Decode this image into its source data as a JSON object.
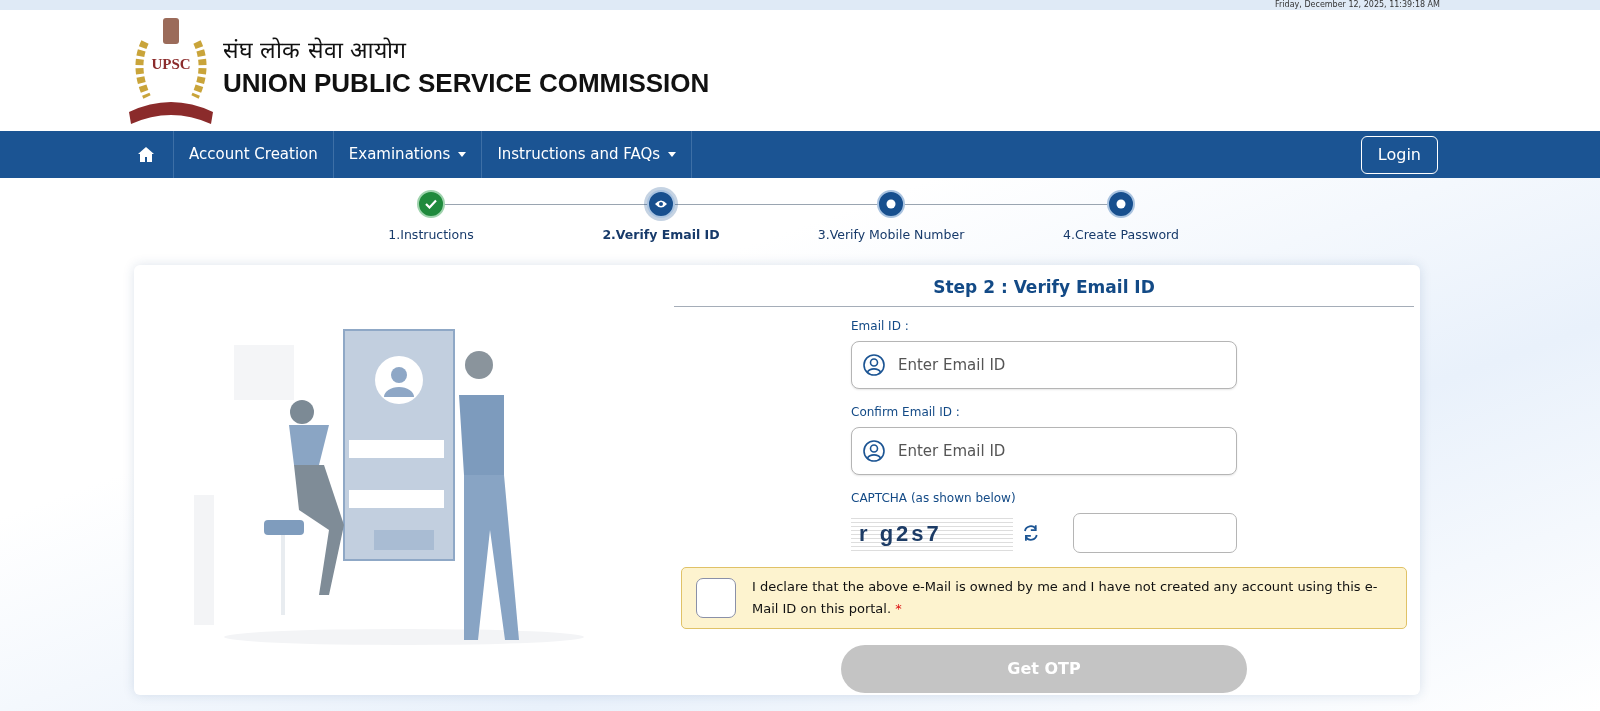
{
  "top_bar": {
    "datetime": "Friday, December 12, 2025, 11:39:18 AM"
  },
  "header": {
    "logo_text": "UPSC",
    "title_hindi": "संघ लोक सेवा आयोग",
    "title_english": "UNION PUBLIC SERVICE COMMISSION"
  },
  "navbar": {
    "items": [
      {
        "kind": "home"
      },
      {
        "kind": "link",
        "label": "Account Creation"
      },
      {
        "kind": "dropdown",
        "label": "Examinations"
      },
      {
        "kind": "dropdown",
        "label": "Instructions and FAQs"
      }
    ],
    "login": "Login"
  },
  "steps": [
    {
      "label": "1.Instructions",
      "done": true,
      "selected": false
    },
    {
      "label": "2.Verify Email ID",
      "done": false,
      "selected": true
    },
    {
      "label": "3.Verify Mobile Number",
      "done": false,
      "selected": false
    },
    {
      "label": "4.Create Password",
      "done": false,
      "selected": false
    }
  ],
  "form": {
    "heading": "Step 2 : Verify Email ID",
    "fields": [
      {
        "label": "Email ID :",
        "placeholder": "Enter Email ID"
      },
      {
        "label": "Confirm Email ID :",
        "placeholder": "Enter Email ID"
      }
    ],
    "captcha": {
      "label": "CAPTCHA (as shown below)",
      "text": "r g2s7"
    },
    "declaration": {
      "checked": false,
      "text": "I declare that the above e-Mail is owned by me and I have not created any account using this e-Mail ID on this portal.",
      "required_mark": "*"
    },
    "submit": {
      "label": "Get OTP",
      "disabled": true
    }
  }
}
